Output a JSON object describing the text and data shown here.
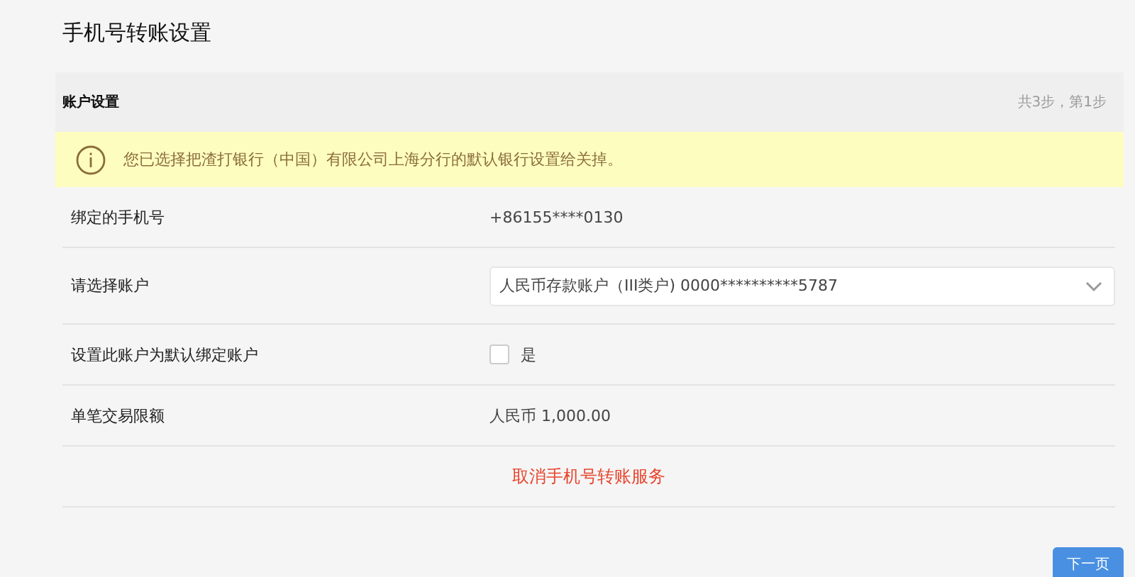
{
  "page": {
    "title": "手机号转账设置"
  },
  "section": {
    "title": "账户设置",
    "step": "共3步，第1步"
  },
  "notice": {
    "text": "您已选择把渣打银行（中国）有限公司上海分行的默认银行设置给关掉。"
  },
  "rows": [
    {
      "kind": "text",
      "label": "绑定的手机号",
      "value": "+86155****0130"
    },
    {
      "kind": "select",
      "label": "请选择账户",
      "value": "人民币存款账户（III类户) 0000**********5787"
    },
    {
      "kind": "checkbox",
      "label": "设置此账户为默认绑定账户",
      "option": "是",
      "checked": false
    },
    {
      "kind": "text",
      "label": "单笔交易限额",
      "value": "人民币 1,000.00"
    }
  ],
  "cancel_link": "取消手机号转账服务",
  "next_button": "下一页"
}
